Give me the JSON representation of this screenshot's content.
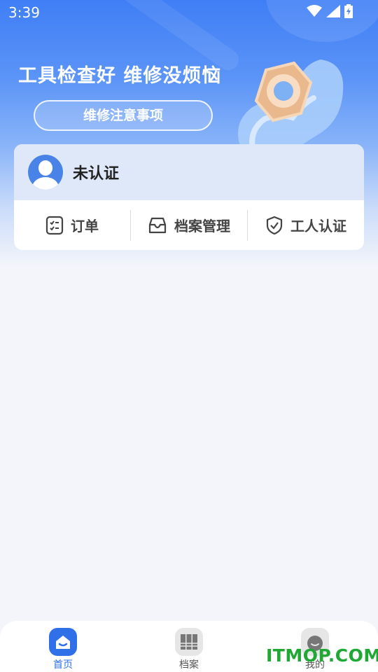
{
  "status_bar": {
    "time": "3:39"
  },
  "banner": {
    "slogan": "工具检查好 维修没烦恼",
    "notice_button": "维修注意事项"
  },
  "user_card": {
    "name": "未认证",
    "menu": [
      {
        "label": "订单",
        "icon": "order-list-icon"
      },
      {
        "label": "档案管理",
        "icon": "archive-box-icon"
      },
      {
        "label": "工人认证",
        "icon": "shield-check-icon"
      }
    ]
  },
  "bottom_nav": {
    "items": [
      {
        "label": "首页",
        "icon": "home-icon",
        "active": true
      },
      {
        "label": "档案",
        "icon": "files-icon",
        "active": false
      },
      {
        "label": "我的",
        "icon": "profile-icon",
        "active": false
      }
    ]
  },
  "watermark": "ITMOP.COM",
  "colors": {
    "primary": "#2f6fe8",
    "watermark": "#1fa834"
  }
}
